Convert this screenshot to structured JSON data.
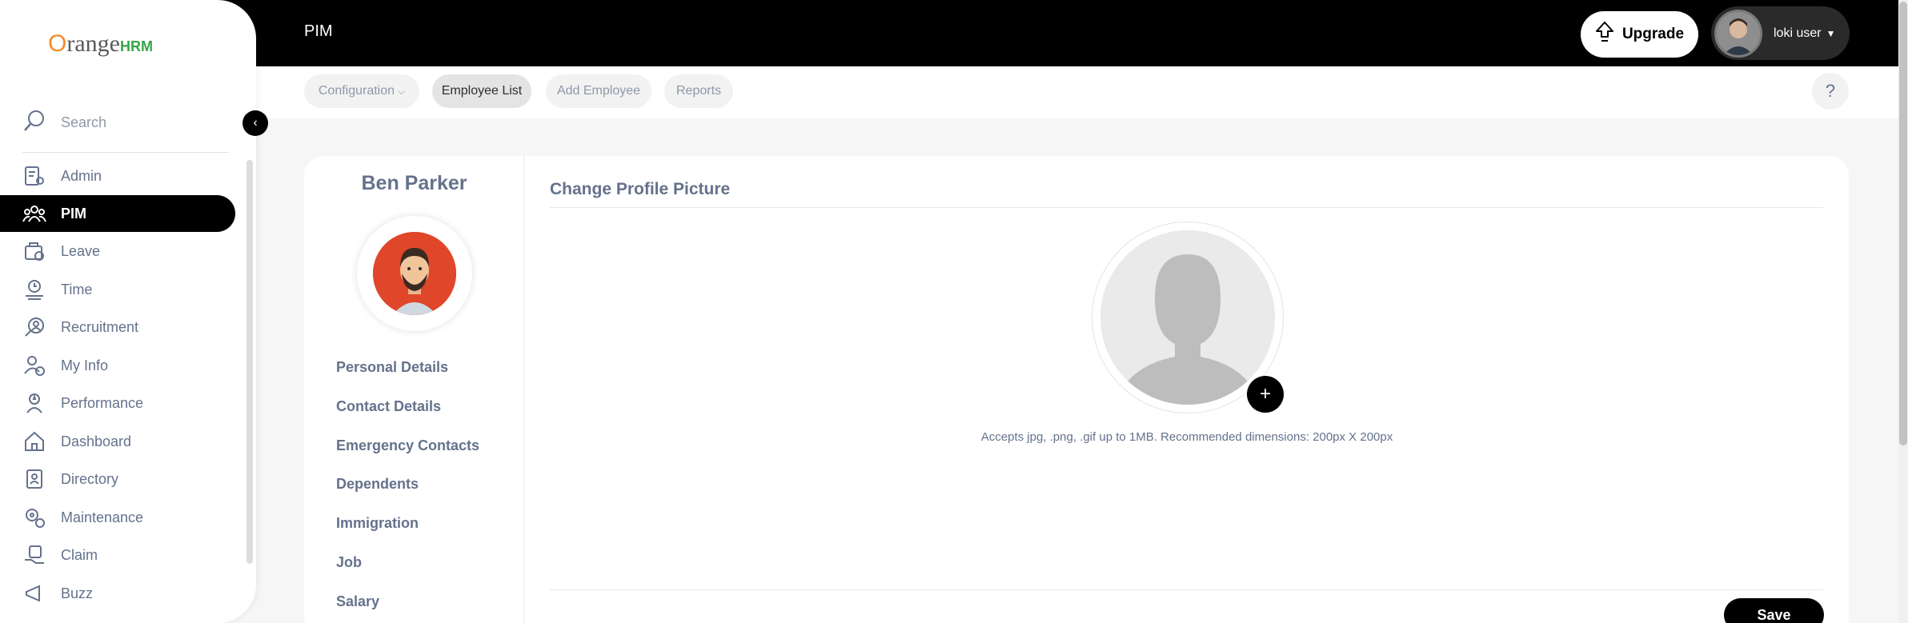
{
  "header": {
    "title": "PIM",
    "upgrade_label": "Upgrade",
    "user_name": "loki user"
  },
  "subnav": {
    "items": [
      {
        "label": "Configuration"
      },
      {
        "label": "Employee List"
      },
      {
        "label": "Add Employee"
      },
      {
        "label": "Reports"
      }
    ],
    "help_label": "?"
  },
  "sidebar": {
    "logo": {
      "o": "O",
      "range": "range",
      "hrm": "HRM"
    },
    "search_label": "Search",
    "items": [
      {
        "label": "Admin",
        "icon": "admin-icon"
      },
      {
        "label": "PIM",
        "icon": "pim-icon"
      },
      {
        "label": "Leave",
        "icon": "leave-icon"
      },
      {
        "label": "Time",
        "icon": "time-icon"
      },
      {
        "label": "Recruitment",
        "icon": "recruitment-icon"
      },
      {
        "label": "My Info",
        "icon": "my-info-icon"
      },
      {
        "label": "Performance",
        "icon": "performance-icon"
      },
      {
        "label": "Dashboard",
        "icon": "dashboard-icon"
      },
      {
        "label": "Directory",
        "icon": "directory-icon"
      },
      {
        "label": "Maintenance",
        "icon": "maintenance-icon"
      },
      {
        "label": "Claim",
        "icon": "claim-icon"
      },
      {
        "label": "Buzz",
        "icon": "buzz-icon"
      }
    ]
  },
  "employee": {
    "name": "Ben Parker",
    "tabs": [
      {
        "label": "Personal Details"
      },
      {
        "label": "Contact Details"
      },
      {
        "label": "Emergency Contacts"
      },
      {
        "label": "Dependents"
      },
      {
        "label": "Immigration"
      },
      {
        "label": "Job"
      },
      {
        "label": "Salary"
      }
    ]
  },
  "profile_picture": {
    "title": "Change Profile Picture",
    "hint": "Accepts jpg, .png, .gif up to 1MB. Recommended dimensions: 200px X 200px",
    "plus": "+",
    "save_label": "Save"
  },
  "colors": {
    "accent": "#000000",
    "text": "#64728c",
    "logo_orange": "#f28c28",
    "logo_green": "#36a548"
  }
}
